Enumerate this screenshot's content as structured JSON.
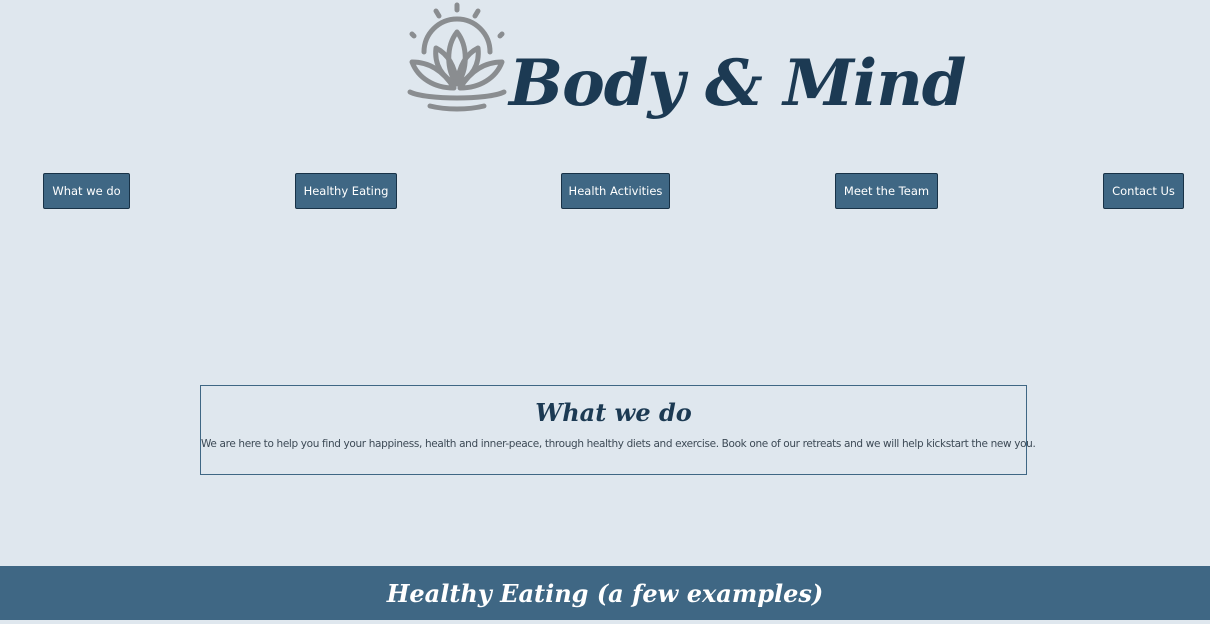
{
  "header": {
    "brand_title": "Body & Mind",
    "logo_icon": "lotus-icon"
  },
  "nav": {
    "items": [
      {
        "label": "What we do"
      },
      {
        "label": "Healthy Eating"
      },
      {
        "label": "Health Activities"
      },
      {
        "label": "Meet the Team"
      },
      {
        "label": "Contact Us"
      }
    ]
  },
  "about": {
    "title": "What we do",
    "text": "We are here to help you find your happiness, health and inner-peace, through healthy diets and exercise. Book one of our retreats and we will help kickstart the new you."
  },
  "section_banner": {
    "title": "Healthy Eating (a few examples)"
  },
  "colors": {
    "background": "#dfe7ee",
    "primary": "#3f6784",
    "heading": "#1c3a53",
    "logo_gray": "#8a8d90"
  }
}
